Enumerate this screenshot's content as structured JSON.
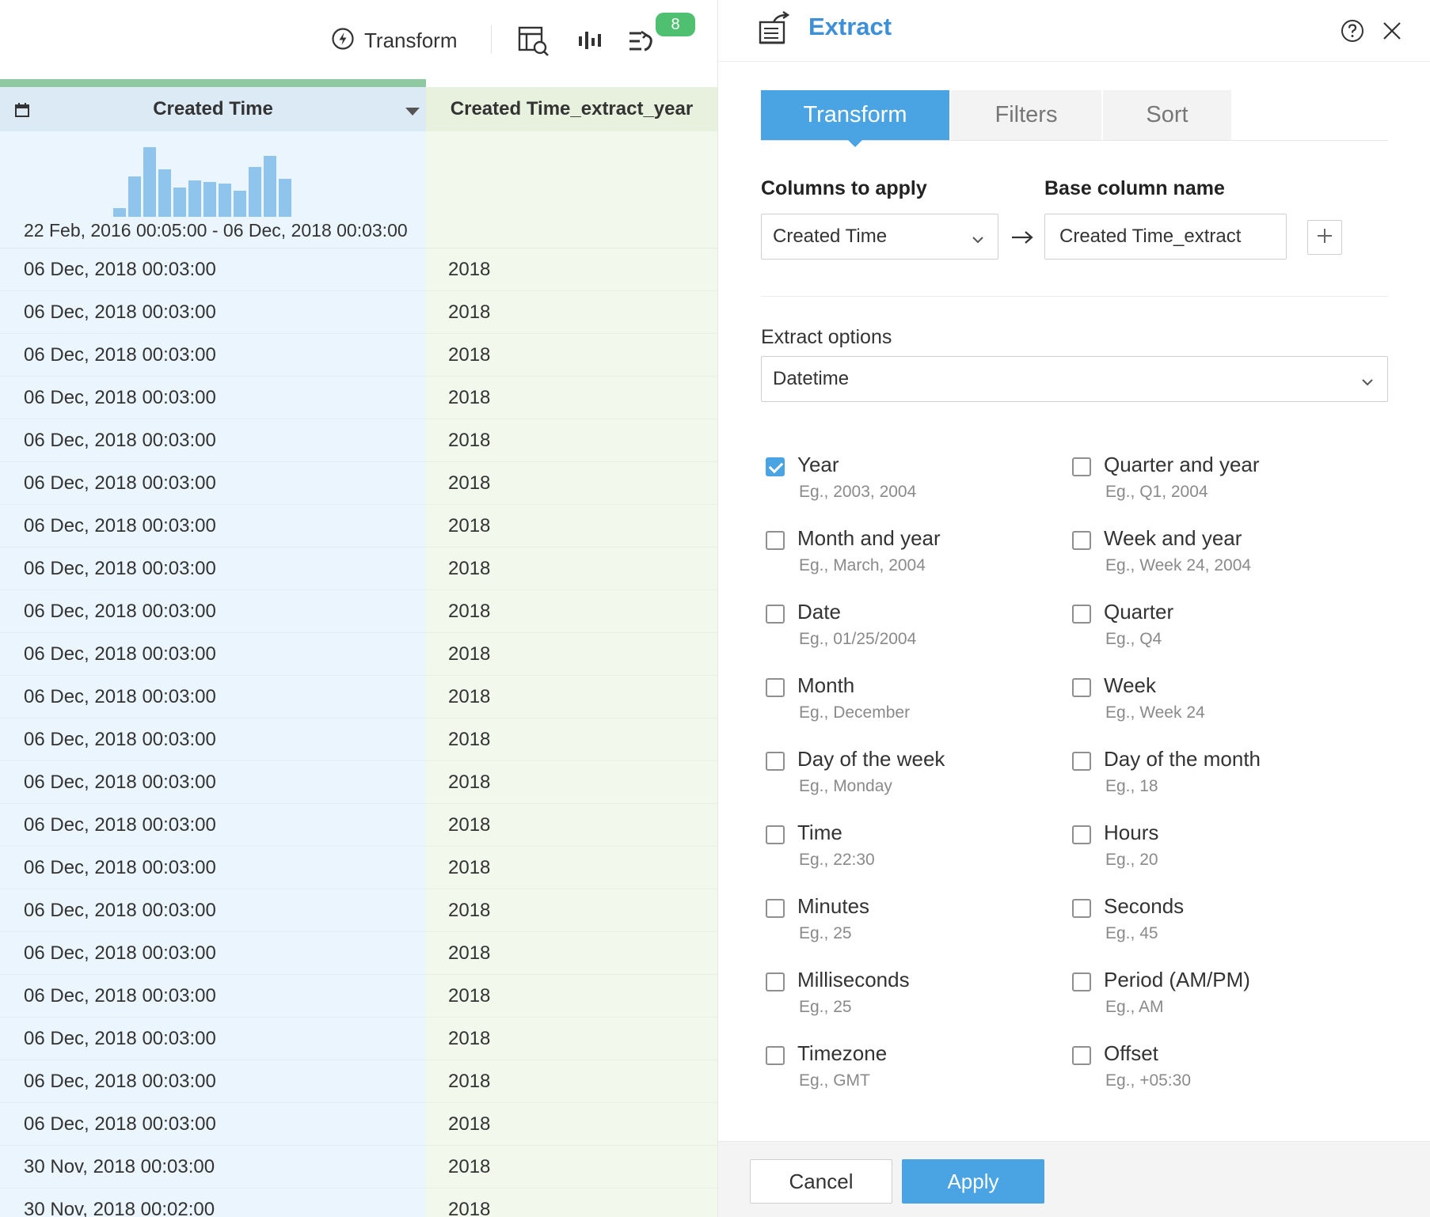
{
  "toolbar": {
    "transform_label": "Transform",
    "badge_count": "8",
    "icons": [
      "lightning-icon",
      "table-search-icon",
      "bar-chart-icon",
      "steps-icon"
    ]
  },
  "grid": {
    "columns": [
      {
        "name": "Created Time",
        "type_icon": "calendar-icon",
        "range": "22 Feb, 2016 00:05:00 - 06 Dec, 2018 00:03:00"
      },
      {
        "name": "Created Time_extract_year"
      }
    ],
    "histogram": [
      0.12,
      0.58,
      1.0,
      0.68,
      0.42,
      0.52,
      0.5,
      0.48,
      0.38,
      0.72,
      0.88,
      0.55
    ],
    "rows": [
      {
        "c1": "06 Dec, 2018 00:03:00",
        "c2": "2018"
      },
      {
        "c1": "06 Dec, 2018 00:03:00",
        "c2": "2018"
      },
      {
        "c1": "06 Dec, 2018 00:03:00",
        "c2": "2018"
      },
      {
        "c1": "06 Dec, 2018 00:03:00",
        "c2": "2018"
      },
      {
        "c1": "06 Dec, 2018 00:03:00",
        "c2": "2018"
      },
      {
        "c1": "06 Dec, 2018 00:03:00",
        "c2": "2018"
      },
      {
        "c1": "06 Dec, 2018 00:03:00",
        "c2": "2018"
      },
      {
        "c1": "06 Dec, 2018 00:03:00",
        "c2": "2018"
      },
      {
        "c1": "06 Dec, 2018 00:03:00",
        "c2": "2018"
      },
      {
        "c1": "06 Dec, 2018 00:03:00",
        "c2": "2018"
      },
      {
        "c1": "06 Dec, 2018 00:03:00",
        "c2": "2018"
      },
      {
        "c1": "06 Dec, 2018 00:03:00",
        "c2": "2018"
      },
      {
        "c1": "06 Dec, 2018 00:03:00",
        "c2": "2018"
      },
      {
        "c1": "06 Dec, 2018 00:03:00",
        "c2": "2018"
      },
      {
        "c1": "06 Dec, 2018 00:03:00",
        "c2": "2018"
      },
      {
        "c1": "06 Dec, 2018 00:03:00",
        "c2": "2018"
      },
      {
        "c1": "06 Dec, 2018 00:03:00",
        "c2": "2018"
      },
      {
        "c1": "06 Dec, 2018 00:03:00",
        "c2": "2018"
      },
      {
        "c1": "06 Dec, 2018 00:03:00",
        "c2": "2018"
      },
      {
        "c1": "06 Dec, 2018 00:03:00",
        "c2": "2018"
      },
      {
        "c1": "06 Dec, 2018 00:03:00",
        "c2": "2018"
      },
      {
        "c1": "30 Nov, 2018 00:03:00",
        "c2": "2018"
      },
      {
        "c1": "30 Nov, 2018 00:02:00",
        "c2": "2018"
      }
    ]
  },
  "panel": {
    "title": "Extract",
    "tabs": [
      {
        "label": "Transform",
        "active": true
      },
      {
        "label": "Filters",
        "active": false
      },
      {
        "label": "Sort",
        "active": false
      }
    ],
    "columns_to_apply_label": "Columns to apply",
    "columns_to_apply_value": "Created Time",
    "base_column_label": "Base column name",
    "base_column_value": "Created Time_extract",
    "extract_options_label": "Extract options",
    "extract_options_value": "Datetime",
    "options": [
      {
        "label": "Year",
        "example": "Eg., 2003, 2004",
        "checked": true
      },
      {
        "label": "Quarter and year",
        "example": "Eg., Q1, 2004",
        "checked": false
      },
      {
        "label": "Month and year",
        "example": "Eg., March, 2004",
        "checked": false
      },
      {
        "label": "Week and year",
        "example": "Eg., Week 24, 2004",
        "checked": false
      },
      {
        "label": "Date",
        "example": "Eg., 01/25/2004",
        "checked": false
      },
      {
        "label": "Quarter",
        "example": "Eg., Q4",
        "checked": false
      },
      {
        "label": "Month",
        "example": "Eg., December",
        "checked": false
      },
      {
        "label": "Week",
        "example": "Eg., Week 24",
        "checked": false
      },
      {
        "label": "Day of the week",
        "example": "Eg., Monday",
        "checked": false
      },
      {
        "label": "Day of the month",
        "example": "Eg., 18",
        "checked": false
      },
      {
        "label": "Time",
        "example": "Eg., 22:30",
        "checked": false
      },
      {
        "label": "Hours",
        "example": "Eg., 20",
        "checked": false
      },
      {
        "label": "Minutes",
        "example": "Eg., 25",
        "checked": false
      },
      {
        "label": "Seconds",
        "example": "Eg., 45",
        "checked": false
      },
      {
        "label": "Milliseconds",
        "example": "Eg., 25",
        "checked": false
      },
      {
        "label": "Period (AM/PM)",
        "example": "Eg., AM",
        "checked": false
      },
      {
        "label": "Timezone",
        "example": "Eg., GMT",
        "checked": false
      },
      {
        "label": "Offset",
        "example": "Eg., +05:30",
        "checked": false
      }
    ],
    "cancel_label": "Cancel",
    "apply_label": "Apply"
  },
  "colors": {
    "accent": "#4aa3e2",
    "title": "#3d8fd8",
    "badge": "#4fbf70",
    "col1_bg": "#eaf5fd",
    "col2_bg": "#f2f8ec",
    "histogram_bar": "#8fc4ec"
  }
}
